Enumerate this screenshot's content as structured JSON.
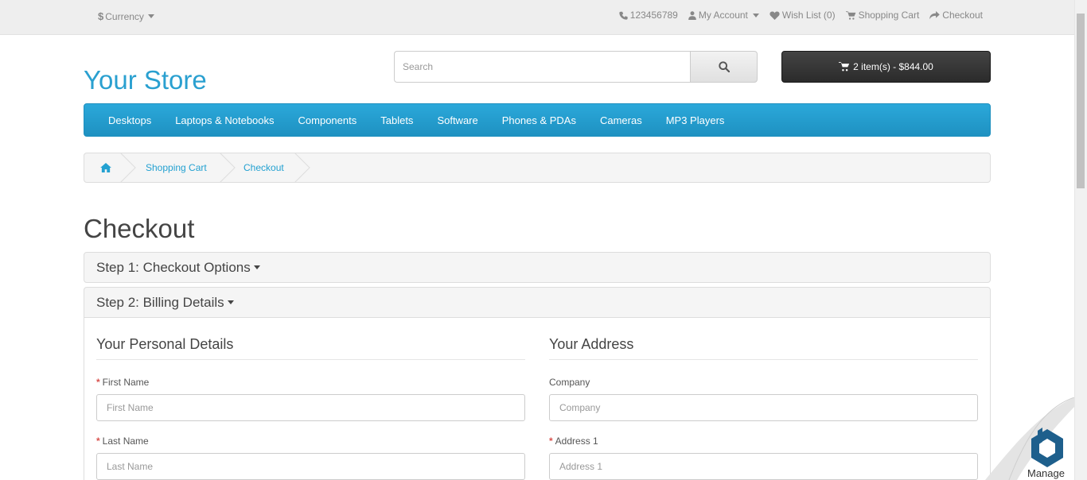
{
  "topbar": {
    "currency_symbol": "$",
    "currency_label": "Currency",
    "phone": "123456789",
    "my_account": "My Account",
    "wish_list": "Wish List (0)",
    "shopping_cart": "Shopping Cart",
    "checkout": "Checkout"
  },
  "header": {
    "logo": "Your Store",
    "search_placeholder": "Search",
    "cart_summary": "2 item(s) - $844.00"
  },
  "menu": [
    "Desktops",
    "Laptops & Notebooks",
    "Components",
    "Tablets",
    "Software",
    "Phones & PDAs",
    "Cameras",
    "MP3 Players"
  ],
  "breadcrumb": {
    "items": [
      "Shopping Cart",
      "Checkout"
    ]
  },
  "page": {
    "title": "Checkout"
  },
  "steps": {
    "step1": "Step 1: Checkout Options",
    "step2": "Step 2: Billing Details"
  },
  "personal": {
    "title": "Your Personal Details",
    "first_name_label": "First Name",
    "first_name_placeholder": "First Name",
    "last_name_label": "Last Name",
    "last_name_placeholder": "Last Name"
  },
  "address": {
    "title": "Your Address",
    "company_label": "Company",
    "company_placeholder": "Company",
    "address1_label": "Address 1",
    "address1_placeholder": "Address 1"
  },
  "widget": {
    "label": "Manage"
  },
  "colors": {
    "accent": "#23a1d1",
    "menu": "#229ac8",
    "required": "#d9534f"
  }
}
